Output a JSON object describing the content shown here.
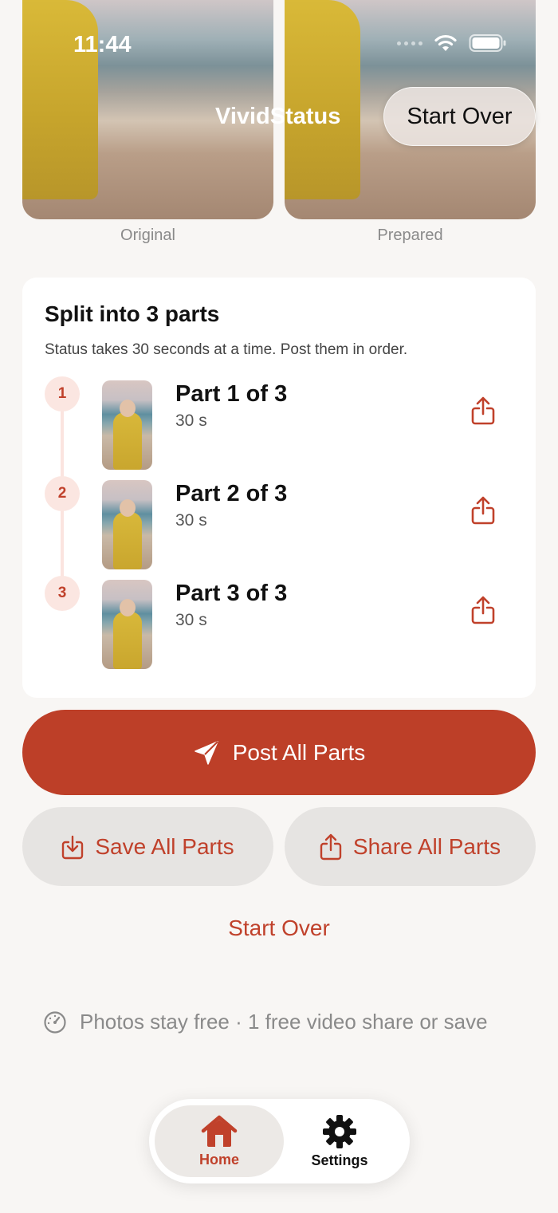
{
  "status_bar": {
    "time": "11:44"
  },
  "header": {
    "title": "VividStatus",
    "start_over_label": "Start Over"
  },
  "previews": {
    "original_label": "Original",
    "prepared_label": "Prepared"
  },
  "split_card": {
    "title": "Split into 3 parts",
    "subtitle": "Status takes 30 seconds at a time. Post them in order.",
    "parts": [
      {
        "number": "1",
        "title": "Part 1 of 3",
        "duration": "30 s"
      },
      {
        "number": "2",
        "title": "Part 2 of 3",
        "duration": "30 s"
      },
      {
        "number": "3",
        "title": "Part 3 of 3",
        "duration": "30 s"
      }
    ]
  },
  "actions": {
    "post_all_label": "Post All Parts",
    "save_all_label": "Save All Parts",
    "share_all_label": "Share All Parts",
    "start_over_label": "Start Over"
  },
  "footer_note": "Photos stay free · 1 free video share or save",
  "tabbar": {
    "home_label": "Home",
    "settings_label": "Settings"
  },
  "colors": {
    "accent": "#bd3f28",
    "accent_text": "#c0412b",
    "background": "#f8f6f4"
  },
  "icons": [
    "wifi-icon",
    "battery-icon",
    "share-icon",
    "send-icon",
    "download-icon",
    "timer-icon",
    "home-icon",
    "gear-icon"
  ]
}
